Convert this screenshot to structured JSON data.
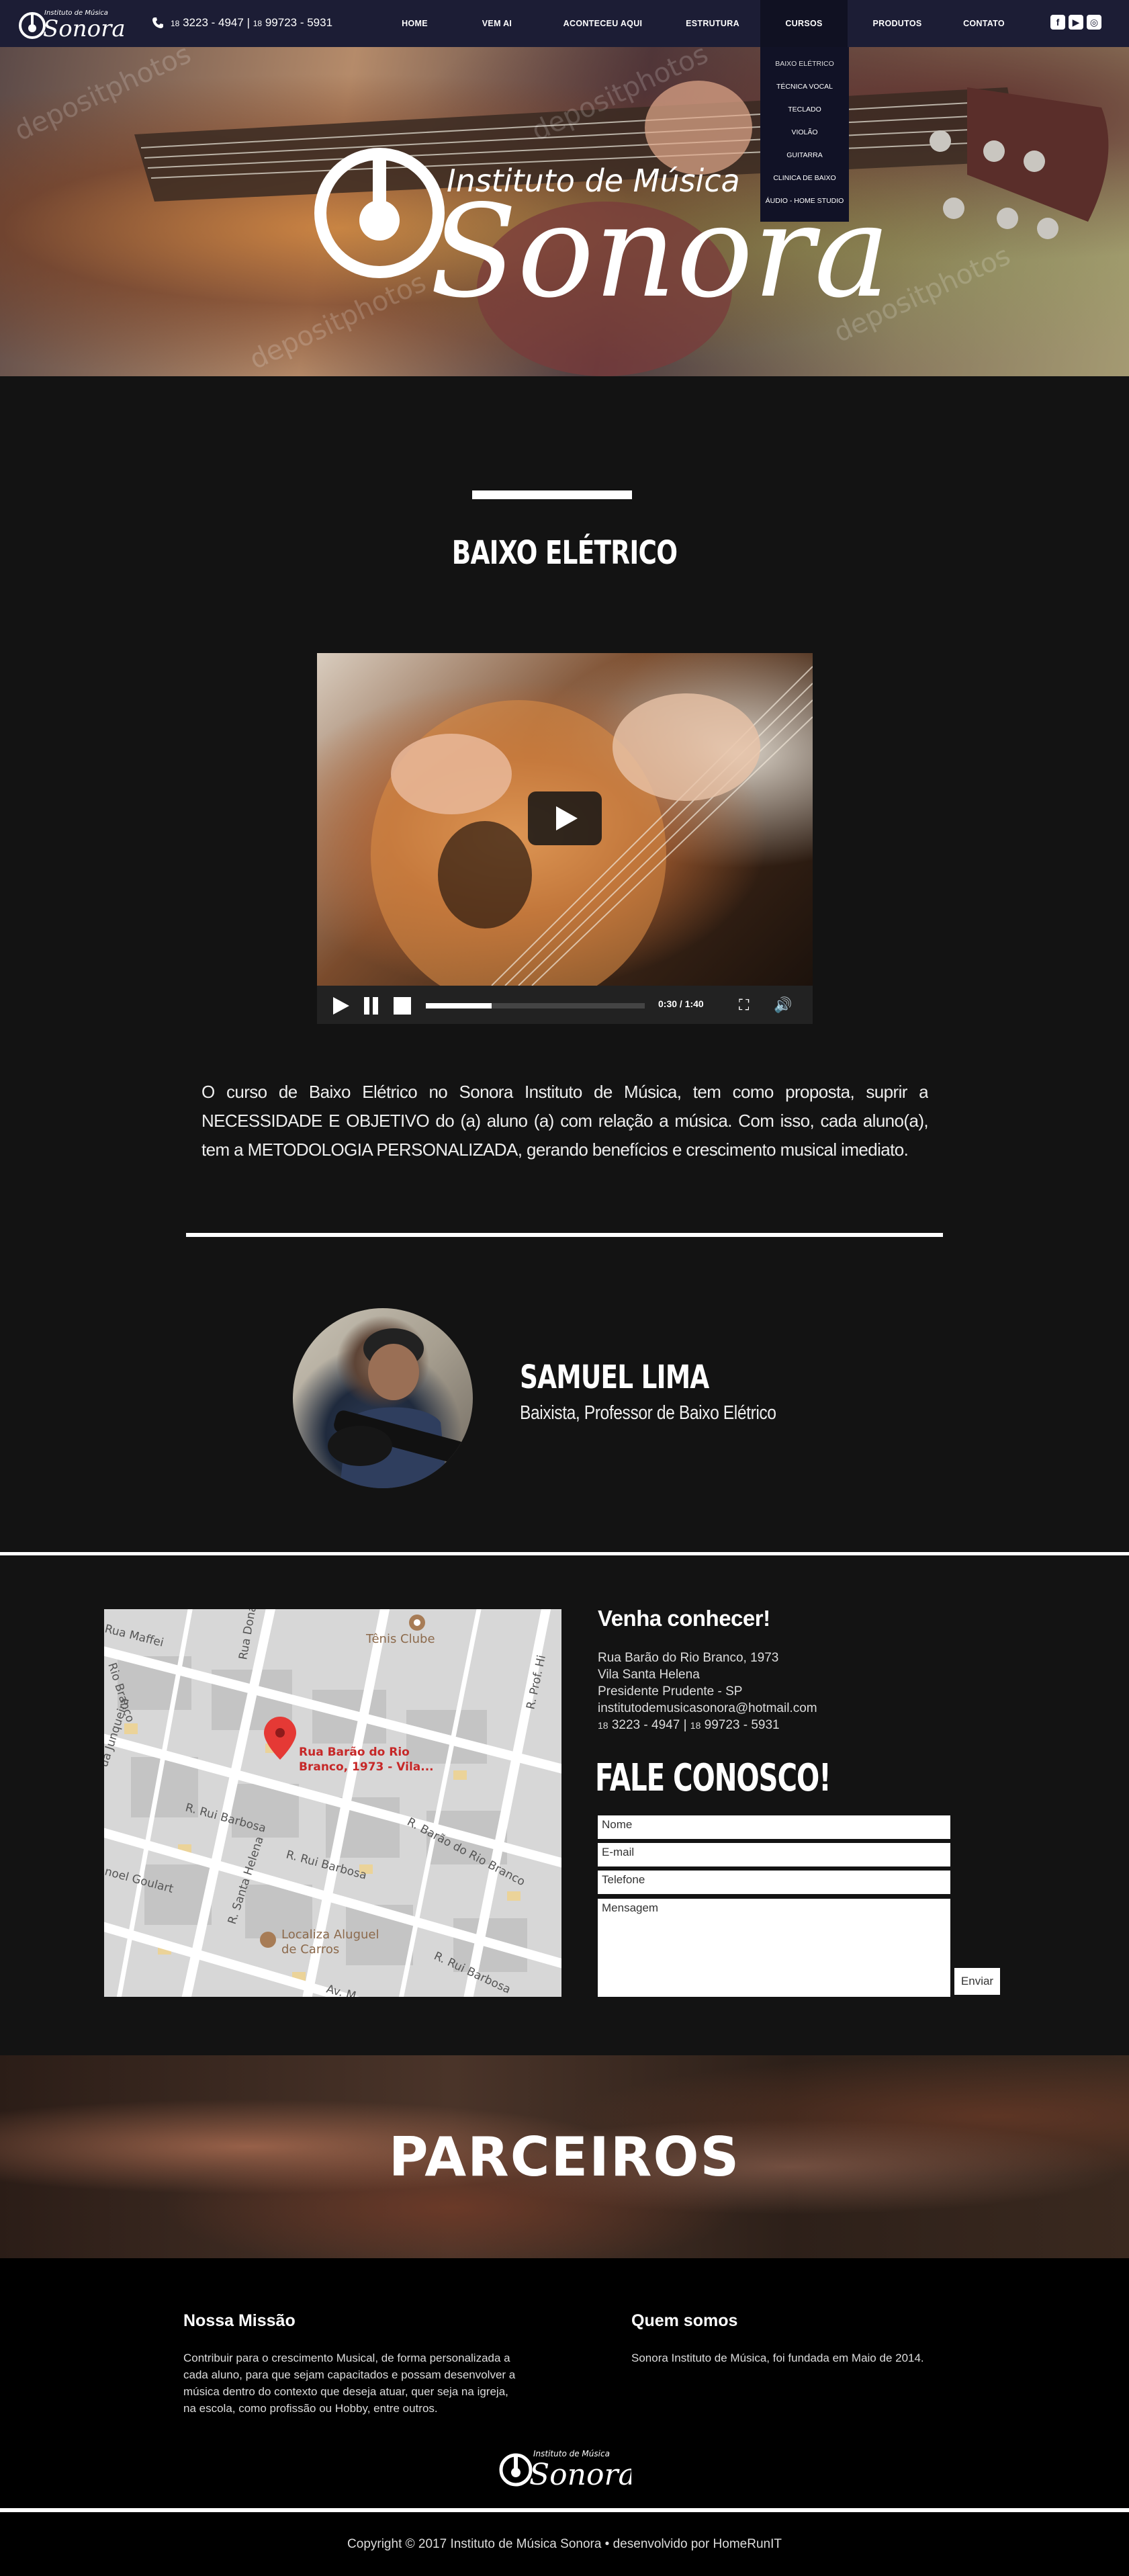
{
  "nav": {
    "logo": {
      "line1": "Instituto de Música",
      "line2": "Sonora"
    },
    "phone": {
      "ddd1": "18",
      "number1": "3223 - 4947",
      "sep": "|",
      "ddd2": "18",
      "number2": "99723 - 5931"
    },
    "menu": [
      "HOME",
      "VEM AI",
      "ACONTECEU AQUI",
      "ESTRUTURA",
      "CURSOS",
      "PRODUTOS",
      "CONTATO"
    ],
    "active": "CURSOS",
    "social": [
      "facebook-icon",
      "youtube-icon",
      "instagram-icon"
    ],
    "dropdown": [
      "BAIXO ELÉTRICO",
      "TÉCNICA VOCAL",
      "TECLADO",
      "VIOLÃO",
      "GUITARRA",
      "CLINICA DE BAIXO",
      "ÁUDIO - HOME STUDIO"
    ]
  },
  "hero": {
    "logo_line1": "Instituto de Música",
    "logo_line2": "Sonora",
    "watermark": "depositphotos"
  },
  "course": {
    "title": "BAIXO ELÉTRICO",
    "video": {
      "time": "0:30 / 1:40",
      "progress": 0.3
    },
    "description": "O curso de Baixo Elétrico no Sonora Instituto de Música,  tem como proposta, suprir a NECESSIDADE E OBJETIVO do (a) aluno (a) com relação a música. Com isso, cada aluno(a), tem a METODOLOGIA PERSONALIZADA, gerando benefícios e crescimento musical imediato."
  },
  "teacher": {
    "name": "SAMUEL LIMA",
    "role": "Baixista, Professor de Baixo Elétrico"
  },
  "contact": {
    "map": {
      "pin_label": [
        "Rua Barão do Rio",
        "Branco, 1973 -  Vila..."
      ],
      "places": [
        "Tênis Clube",
        "Localiza Aluguel",
        "de Carros"
      ],
      "streets": [
        "Rua Maffei",
        "Rio Branco",
        "Rua Dona Mitilda",
        "R. Prof. Hi",
        "ua Junqueira",
        "R. Rui Barbosa",
        "R. Barão do Rio Branco",
        "R. Rui Barbosa",
        "noel Goulart",
        "R. Santa Helena",
        "R. Rui Barbosa",
        "Av. M"
      ]
    },
    "visit_title": "Venha conhecer!",
    "address": [
      "Rua Barão do Rio Branco, 1973",
      "Vila Santa Helena",
      "Presidente Prudente - SP",
      "institutodemusicasonora@hotmail.com"
    ],
    "phone_line": {
      "ddd1": "18",
      "number1": "3223 - 4947",
      "sep": "|",
      "ddd2": "18",
      "number2": "99723 - 5931"
    },
    "form_title": "FALE CONOSCO!",
    "fields": {
      "name": "Nome",
      "email": "E-mail",
      "phone": "Telefone",
      "message": "Mensagem"
    },
    "send": "Enviar"
  },
  "partners": {
    "title": "PARCEIROS"
  },
  "footer": {
    "mission_title": "Nossa Missão",
    "mission_text": [
      "Contribuir para o crescimento Musical, de forma personalizada a",
      "cada aluno, para que sejam capacitados e possam desenvolver a",
      "música dentro do contexto que deseja atuar, quer seja na igreja,",
      "na escola, como profissão ou Hobby, entre outros."
    ],
    "about_title": "Quem somos",
    "about_text": "Sonora Instituto de Música, foi fundada em Maio de 2014.",
    "logo": {
      "line1": "Instituto de Música",
      "line2": "Sonora"
    },
    "copyright": "Copyright © 2017 Instituto de Música Sonora  •  desenvolvido por HomeRunIT"
  }
}
